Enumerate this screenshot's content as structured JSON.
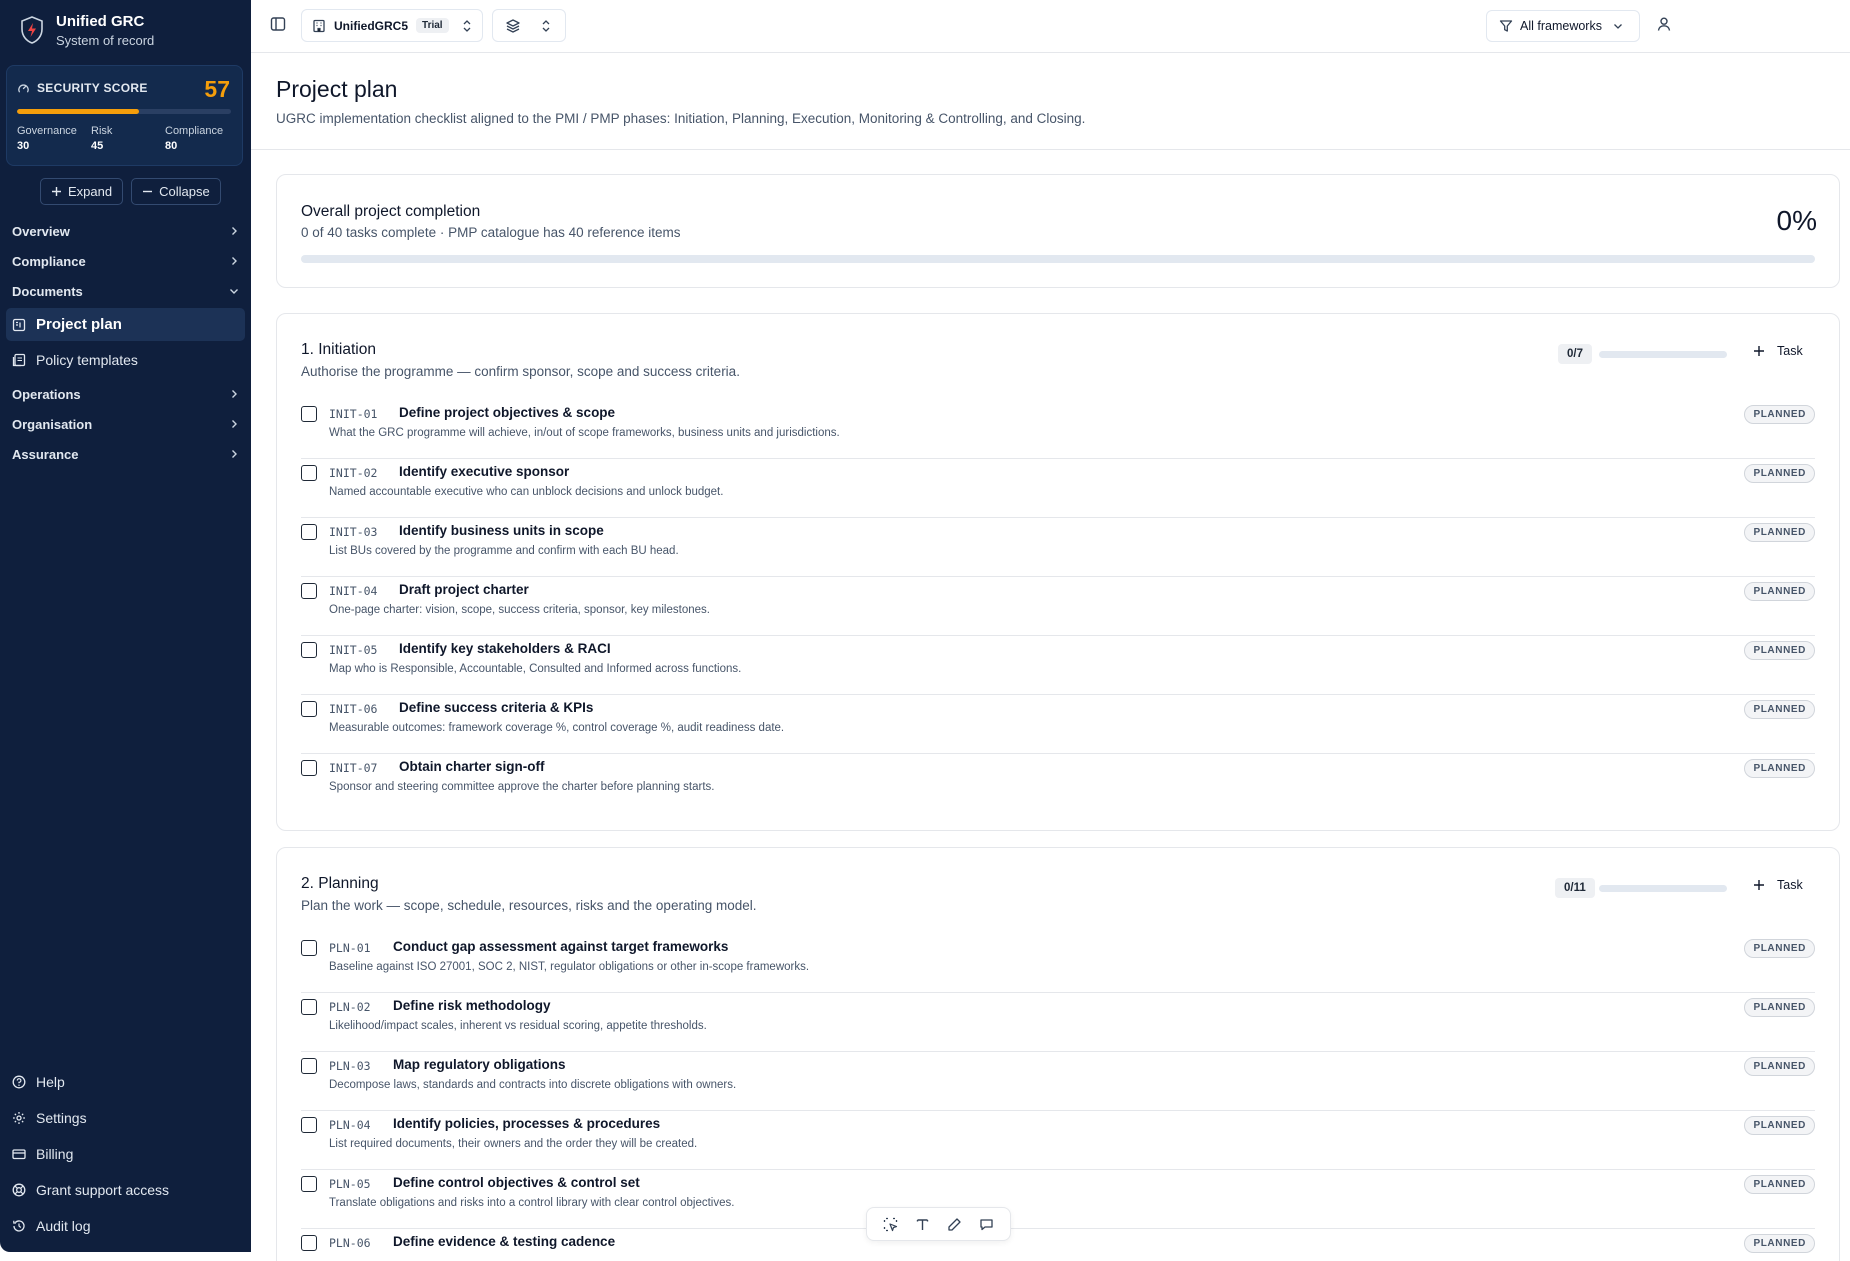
{
  "brand": {
    "title": "Unified GRC",
    "subtitle": "System of record"
  },
  "score": {
    "label": "SECURITY SCORE",
    "value": "57",
    "progress": 0.57,
    "metrics": [
      {
        "label": "Governance",
        "value": "30"
      },
      {
        "label": "Risk",
        "value": "45"
      },
      {
        "label": "Compliance",
        "value": "80"
      }
    ]
  },
  "sidebar": {
    "expand_label": "Expand",
    "collapse_label": "Collapse",
    "groups": {
      "overview": "Overview",
      "compliance": "Compliance",
      "documents": "Documents",
      "operations": "Operations",
      "organisation": "Organisation",
      "assurance": "Assurance"
    },
    "documents_items": [
      "Project plan",
      "Policy templates"
    ],
    "bottom_items": [
      "Help",
      "Settings",
      "Billing",
      "Grant support access",
      "Audit log"
    ]
  },
  "topbar": {
    "org_name": "UnifiedGRC5",
    "org_badge": "Trial",
    "framework_filter": "All frameworks"
  },
  "page": {
    "title": "Project plan",
    "subtitle": "UGRC implementation checklist aligned to the PMI / PMP phases: Initiation, Planning, Execution, Monitoring & Controlling, and Closing."
  },
  "overall": {
    "title": "Overall project completion",
    "subtitle": "0 of 40 tasks complete · PMP catalogue has 40 reference items",
    "percent": "0%",
    "progress": 0
  },
  "phases": [
    {
      "title": "1. Initiation",
      "subtitle": "Authorise the programme — confirm sponsor, scope and success criteria.",
      "count": "0/7",
      "progress": 0,
      "task_label": "Task",
      "tasks": [
        {
          "code": "INIT-01",
          "title": "Define project objectives & scope",
          "desc": "What the GRC programme will achieve, in/out of scope frameworks, business units and jurisdictions.",
          "status": "PLANNED"
        },
        {
          "code": "INIT-02",
          "title": "Identify executive sponsor",
          "desc": "Named accountable executive who can unblock decisions and unlock budget.",
          "status": "PLANNED"
        },
        {
          "code": "INIT-03",
          "title": "Identify business units in scope",
          "desc": "List BUs covered by the programme and confirm with each BU head.",
          "status": "PLANNED"
        },
        {
          "code": "INIT-04",
          "title": "Draft project charter",
          "desc": "One-page charter: vision, scope, success criteria, sponsor, key milestones.",
          "status": "PLANNED"
        },
        {
          "code": "INIT-05",
          "title": "Identify key stakeholders & RACI",
          "desc": "Map who is Responsible, Accountable, Consulted and Informed across functions.",
          "status": "PLANNED"
        },
        {
          "code": "INIT-06",
          "title": "Define success criteria & KPIs",
          "desc": "Measurable outcomes: framework coverage %, control coverage %, audit readiness date.",
          "status": "PLANNED"
        },
        {
          "code": "INIT-07",
          "title": "Obtain charter sign-off",
          "desc": "Sponsor and steering committee approve the charter before planning starts.",
          "status": "PLANNED"
        }
      ]
    },
    {
      "title": "2. Planning",
      "subtitle": "Plan the work — scope, schedule, resources, risks and the operating model.",
      "count": "0/11",
      "progress": 0,
      "task_label": "Task",
      "tasks": [
        {
          "code": "PLN-01",
          "title": "Conduct gap assessment against target frameworks",
          "desc": "Baseline against ISO 27001, SOC 2, NIST, regulator obligations or other in-scope frameworks.",
          "status": "PLANNED"
        },
        {
          "code": "PLN-02",
          "title": "Define risk methodology",
          "desc": "Likelihood/impact scales, inherent vs residual scoring, appetite thresholds.",
          "status": "PLANNED"
        },
        {
          "code": "PLN-03",
          "title": "Map regulatory obligations",
          "desc": "Decompose laws, standards and contracts into discrete obligations with owners.",
          "status": "PLANNED"
        },
        {
          "code": "PLN-04",
          "title": "Identify policies, processes & procedures",
          "desc": "List required documents, their owners and the order they will be created.",
          "status": "PLANNED"
        },
        {
          "code": "PLN-05",
          "title": "Define control objectives & control set",
          "desc": "Translate obligations and risks into a control library with clear control objectives.",
          "status": "PLANNED"
        },
        {
          "code": "PLN-06",
          "title": "Define evidence & testing cadence",
          "desc": "",
          "status": "PLANNED"
        }
      ]
    }
  ]
}
